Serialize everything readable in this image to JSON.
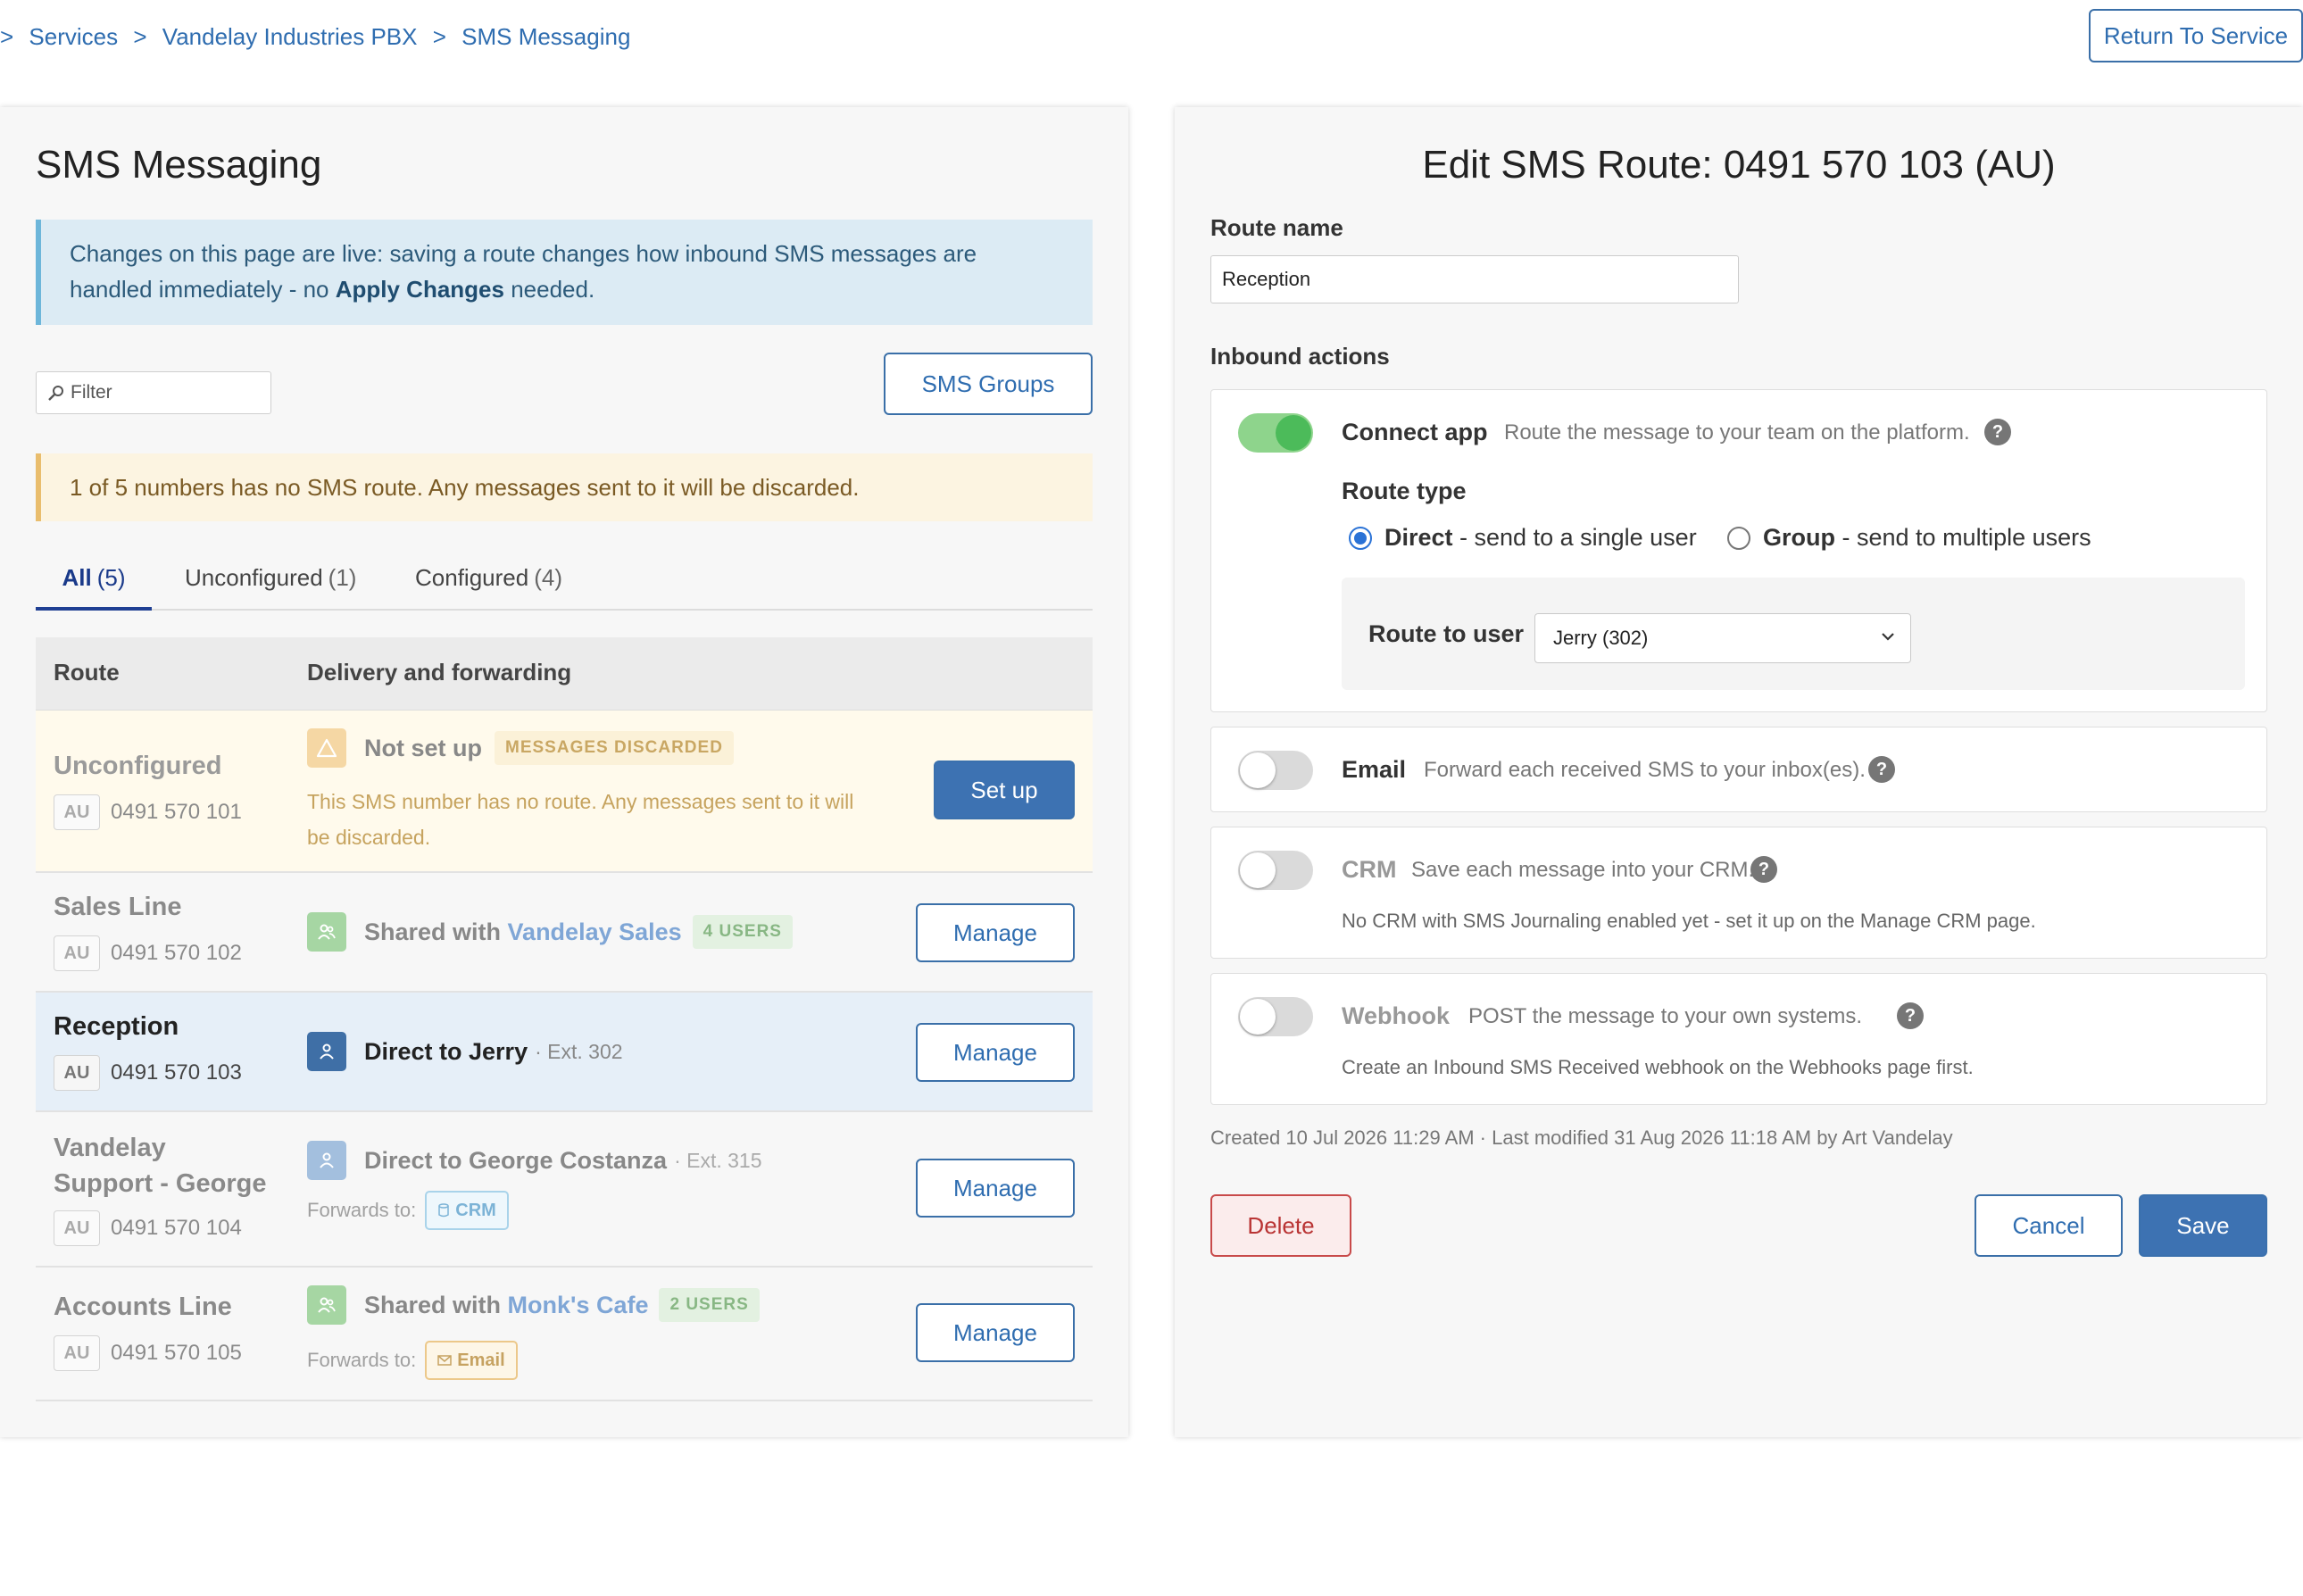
{
  "breadcrumb": {
    "root_sep": ">",
    "items": [
      "Services",
      "Vandelay Industries PBX",
      "SMS Messaging"
    ],
    "sep": ">"
  },
  "header": {
    "return_label": "Return To Service"
  },
  "left": {
    "title": "SMS Messaging",
    "info": {
      "before": "Changes on this page are live: saving a route changes how inbound SMS messages are handled immediately - no ",
      "bold": "Apply Changes",
      "after": " needed."
    },
    "filter_placeholder": "Filter",
    "sms_groups_label": "SMS Groups",
    "warning": "1 of 5 numbers has no SMS route. Any messages sent to it will be discarded.",
    "tabs": [
      {
        "label": "All",
        "count": "(5)",
        "active": true
      },
      {
        "label": "Unconfigured",
        "count": "(1)"
      },
      {
        "label": "Configured",
        "count": "(4)"
      }
    ],
    "columns": {
      "route": "Route",
      "delivery": "Delivery and forwarding"
    },
    "rows": [
      {
        "name": "Unconfigured",
        "country": "AU",
        "number": "0491 570 101",
        "icon": "warning-icon",
        "title": "Not set up",
        "tag": "MESSAGES DISCARDED",
        "description": "This SMS number has no route. Any messages sent to it will be discarded.",
        "action": "Set up",
        "bg": "#fffaec"
      },
      {
        "name": "Sales Line",
        "country": "AU",
        "number": "0491 570 102",
        "icon": "group-icon",
        "title_prefix": "Shared with ",
        "title_link": "Vandelay Sales",
        "tag": "4 USERS",
        "action": "Manage",
        "bg": "#f7f7f7"
      },
      {
        "name": "Reception",
        "country": "AU",
        "number": "0491 570 103",
        "icon": "user-icon",
        "title": "Direct to Jerry",
        "sub": "· Ext. 302",
        "action": "Manage",
        "bg": "#e6eff8"
      },
      {
        "name_line1": "Vandelay",
        "name_line2": "Support - George",
        "country": "AU",
        "number": "0491 570 104",
        "icon": "user-icon",
        "title": "Direct to George Costanza",
        "sub": "· Ext. 315",
        "forwards_label": "Forwards to:",
        "forward_chip": "CRM",
        "forward_icon": "database-icon",
        "action": "Manage",
        "bg": "#f7f7f7"
      },
      {
        "name": "Accounts Line",
        "country": "AU",
        "number": "0491 570 105",
        "icon": "group-icon",
        "title_prefix": "Shared with ",
        "title_link": "Monk's Cafe",
        "tag": "2 USERS",
        "forwards_label": "Forwards to:",
        "forward_chip": "Email",
        "forward_icon": "envelope-icon",
        "action": "Manage",
        "bg": "#f7f7f7"
      }
    ]
  },
  "right": {
    "title": "Edit SMS Route: 0491 570 103 (AU)",
    "route_name_label": "Route name",
    "route_name_value": "Reception",
    "inbound_label": "Inbound actions",
    "connect": {
      "title": "Connect app",
      "desc": "Route the message to your team on the platform.",
      "enabled": true,
      "route_type_label": "Route type",
      "direct_bold": "Direct",
      "direct_rest": " - send to a single user",
      "group_bold": "Group",
      "group_rest": " - send to multiple users",
      "selected": "Direct",
      "route_to_user_label": "Route to user",
      "route_to_user_value": "Jerry (302)"
    },
    "email": {
      "title": "Email",
      "desc": "Forward each received SMS to your inbox(es).",
      "enabled": false
    },
    "crm": {
      "title": "CRM",
      "desc": "Save each message into your CRM.",
      "note": "No CRM with SMS Journaling enabled yet - set it up on the Manage CRM page.",
      "enabled": false
    },
    "webhook": {
      "title": "Webhook",
      "desc": "POST the message to your own systems.",
      "note": "Create an Inbound SMS Received webhook on the Webhooks page first.",
      "enabled": false
    },
    "meta": "Created 10 Jul 2026 11:29 AM · Last modified 31 Aug 2026 11:18 AM by Art Vandelay",
    "delete_label": "Delete",
    "cancel_label": "Cancel",
    "save_label": "Save",
    "help_glyph": "?"
  },
  "colors": {
    "link": "#2f6db0",
    "primary": "#3d72b2",
    "toggle_on": "#4cbb5a",
    "danger": "#c84a4a"
  }
}
